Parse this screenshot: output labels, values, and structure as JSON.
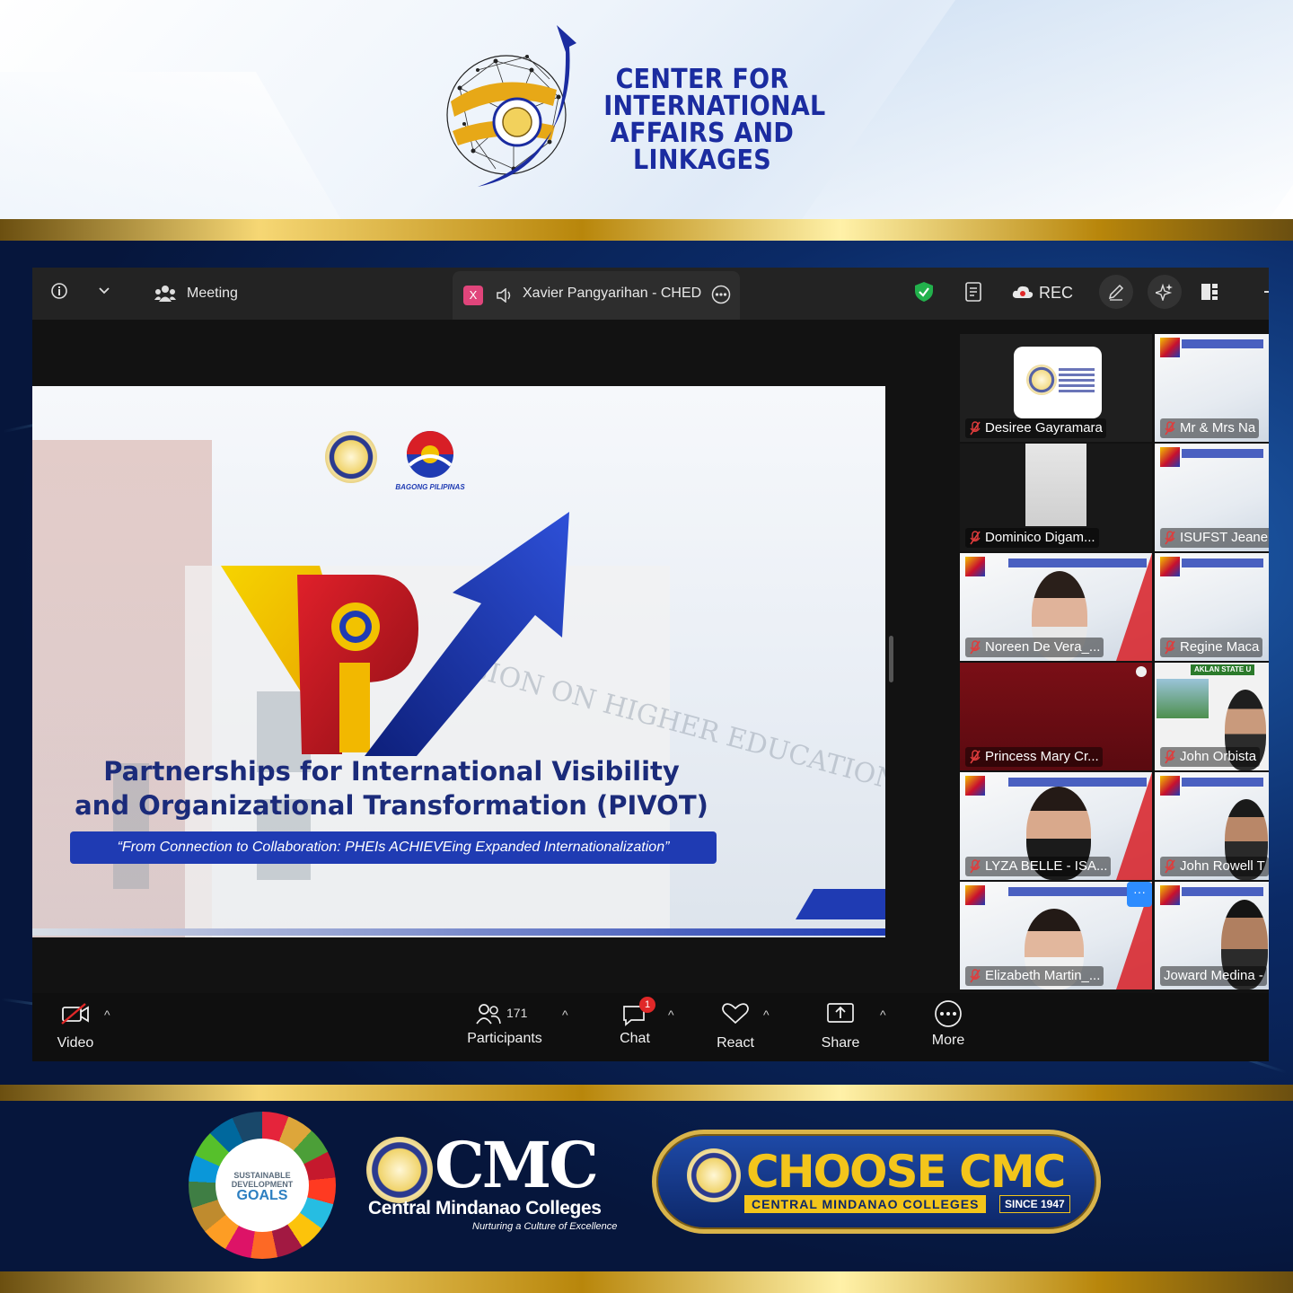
{
  "header": {
    "title_lines": [
      "CENTER FOR",
      "INTERNATIONAL",
      "AFFAIRS AND",
      "LINKAGES"
    ]
  },
  "zoom": {
    "topbar": {
      "view_label": "Meeting",
      "speaker_name": "Xavier Pangyarihan - CHED I/",
      "speaker_badge": "X",
      "rec_label": "REC"
    },
    "slide": {
      "partner_caption": "BAGONG PILIPINAS",
      "title_line1": "Partnerships for International Visibility",
      "title_line2": "and Organizational Transformation (PIVOT)",
      "subtitle": "“From Connection to Collaboration: PHEIs ACHIEVEing Expanded Internationalization”",
      "backdrop_text": "SION ON HIGHER EDUCATION"
    },
    "participants": [
      {
        "name": "Desiree Gayramara"
      },
      {
        "name": "Mr & Mrs Na"
      },
      {
        "name": "Dominico Digam..."
      },
      {
        "name": "ISUFST Jeane"
      },
      {
        "name": "Noreen De Vera_..."
      },
      {
        "name": "Regine Maca"
      },
      {
        "name": "Princess Mary Cr..."
      },
      {
        "name": "John Orbista"
      },
      {
        "name": "LYZA BELLE - ISA..."
      },
      {
        "name": "John Rowell T"
      },
      {
        "name": "Elizabeth Martin_..."
      },
      {
        "name": "Joward Medina -"
      }
    ],
    "tile_banner": "AKLAN STATE U",
    "toolbar": {
      "video_label": "Video",
      "participants_label": "Participants",
      "participants_count": "171",
      "chat_label": "Chat",
      "chat_badge": "1",
      "react_label": "React",
      "share_label": "Share",
      "more_label": "More"
    }
  },
  "footer": {
    "sdg_line1": "SUSTAINABLE",
    "sdg_line2": "DEVELOPMENT",
    "sdg_goals": "GOALS",
    "cmc_short": "CMC",
    "cmc_name": "Central Mindanao Colleges",
    "cmc_tagline": "Nurturing a Culture of Excellence",
    "choose_title": "CHOOSE CMC",
    "choose_strip": "CENTRAL MINDANAO COLLEGES",
    "choose_since": "SINCE 1947"
  },
  "colors": {
    "brand_blue": "#1b2ca0",
    "gold": "#d9b44a",
    "zoom_dark": "#1a1a1a",
    "chat_badge": "#e02828",
    "shield_green": "#22b14c"
  }
}
